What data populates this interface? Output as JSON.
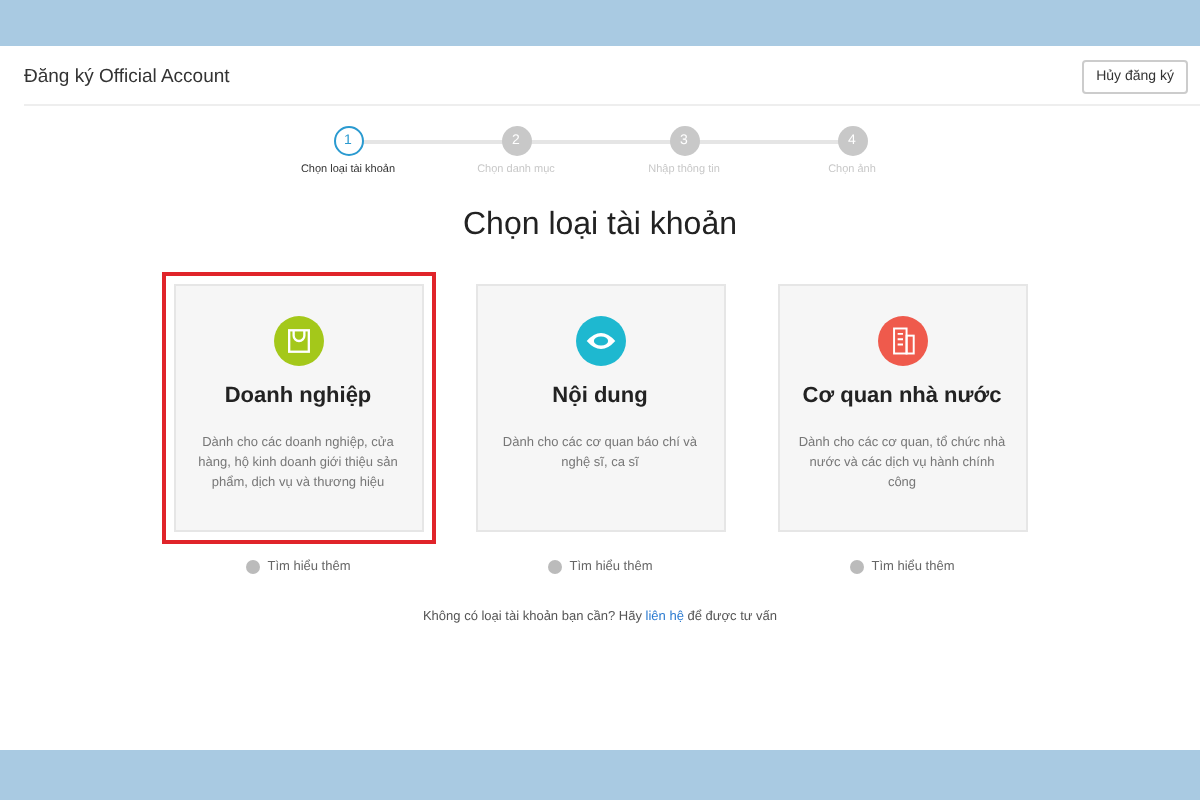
{
  "header": {
    "title": "Đăng ký Official Account",
    "cancel_button": "Hủy đăng ký"
  },
  "steps": [
    {
      "number": "1",
      "label": "Chọn loại tài khoản",
      "selected": true
    },
    {
      "number": "2",
      "label": "Chọn danh mục",
      "selected": false
    },
    {
      "number": "3",
      "label": "Nhập thông tin",
      "selected": false
    },
    {
      "number": "4",
      "label": "Chọn ảnh",
      "selected": false
    }
  ],
  "heading": "Chọn loại tài khoản",
  "cards": [
    {
      "kind": "bag",
      "color": "#a4c81a",
      "title": "Doanh nghiệp",
      "description": "Dành cho các doanh nghiệp, cửa hàng, hộ kinh doanh giới thiệu sản phẩm, dịch vụ và thương hiệu",
      "selected": true,
      "link": "Tìm hiểu thêm"
    },
    {
      "kind": "media",
      "color": "#1eb8d0",
      "title": "Nội dung",
      "description": "Dành cho các cơ quan báo chí và nghệ sĩ, ca sĩ",
      "selected": false,
      "link": "Tìm hiểu thêm"
    },
    {
      "kind": "building",
      "color": "#ef5a4c",
      "title": "Cơ quan nhà nước",
      "description": "Dành cho các cơ quan, tổ chức nhà nước và các dịch vụ hành chính công",
      "selected": false,
      "link": "Tìm hiểu thêm"
    }
  ],
  "footer": {
    "before": "Không có loại tài khoản bạn cần? Hãy",
    "link": "liên hệ",
    "after": "để được tư vấn"
  }
}
